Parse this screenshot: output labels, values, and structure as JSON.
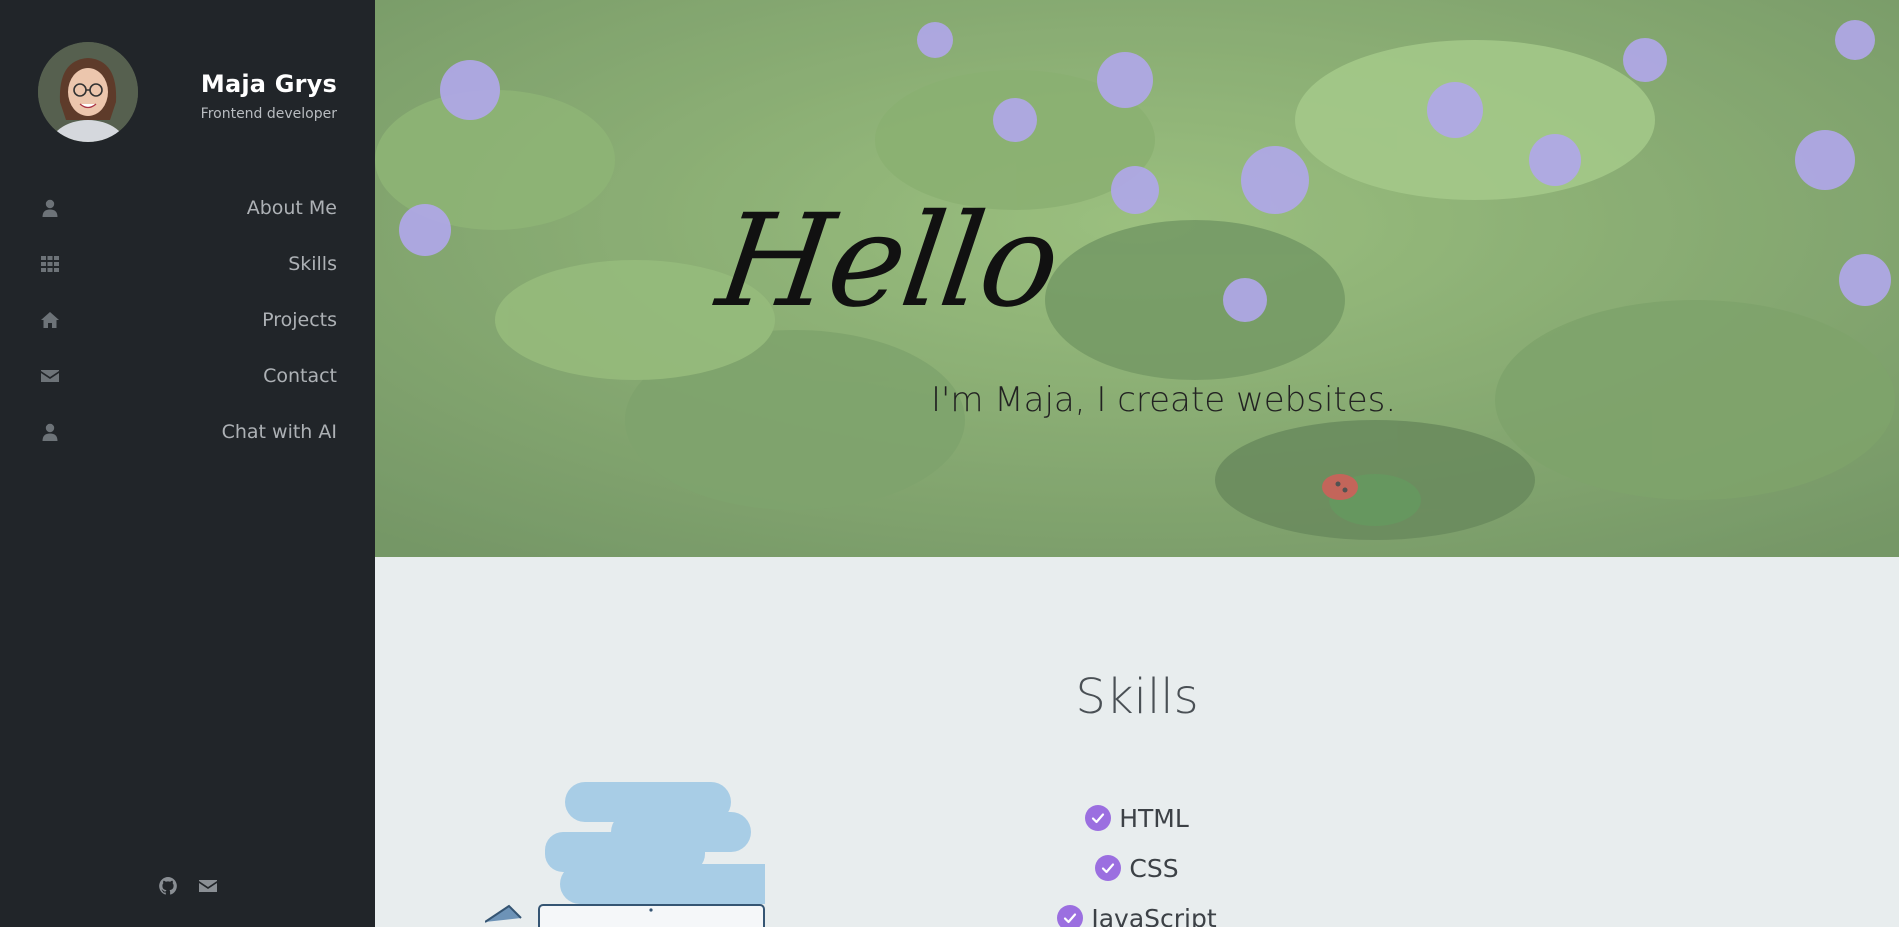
{
  "sidebar": {
    "profile": {
      "name": "Maja Grys",
      "role": "Frontend developer"
    },
    "nav": [
      {
        "label": "About Me",
        "icon": "user-icon"
      },
      {
        "label": "Skills",
        "icon": "grid-icon"
      },
      {
        "label": "Projects",
        "icon": "home-icon"
      },
      {
        "label": "Contact",
        "icon": "envelope-icon"
      },
      {
        "label": "Chat with AI",
        "icon": "user-icon"
      }
    ],
    "social": [
      {
        "icon": "github-icon"
      },
      {
        "icon": "envelope-icon"
      }
    ]
  },
  "hero": {
    "greeting": "Hello",
    "tagline": "I'm Maja, I create websites."
  },
  "skills": {
    "title": "Skills",
    "items": [
      "HTML",
      "CSS",
      "JavaScript"
    ]
  },
  "colors": {
    "sidebar_bg": "#212529",
    "accent": "#9b6fe0",
    "skills_bg": "#e8edee"
  }
}
